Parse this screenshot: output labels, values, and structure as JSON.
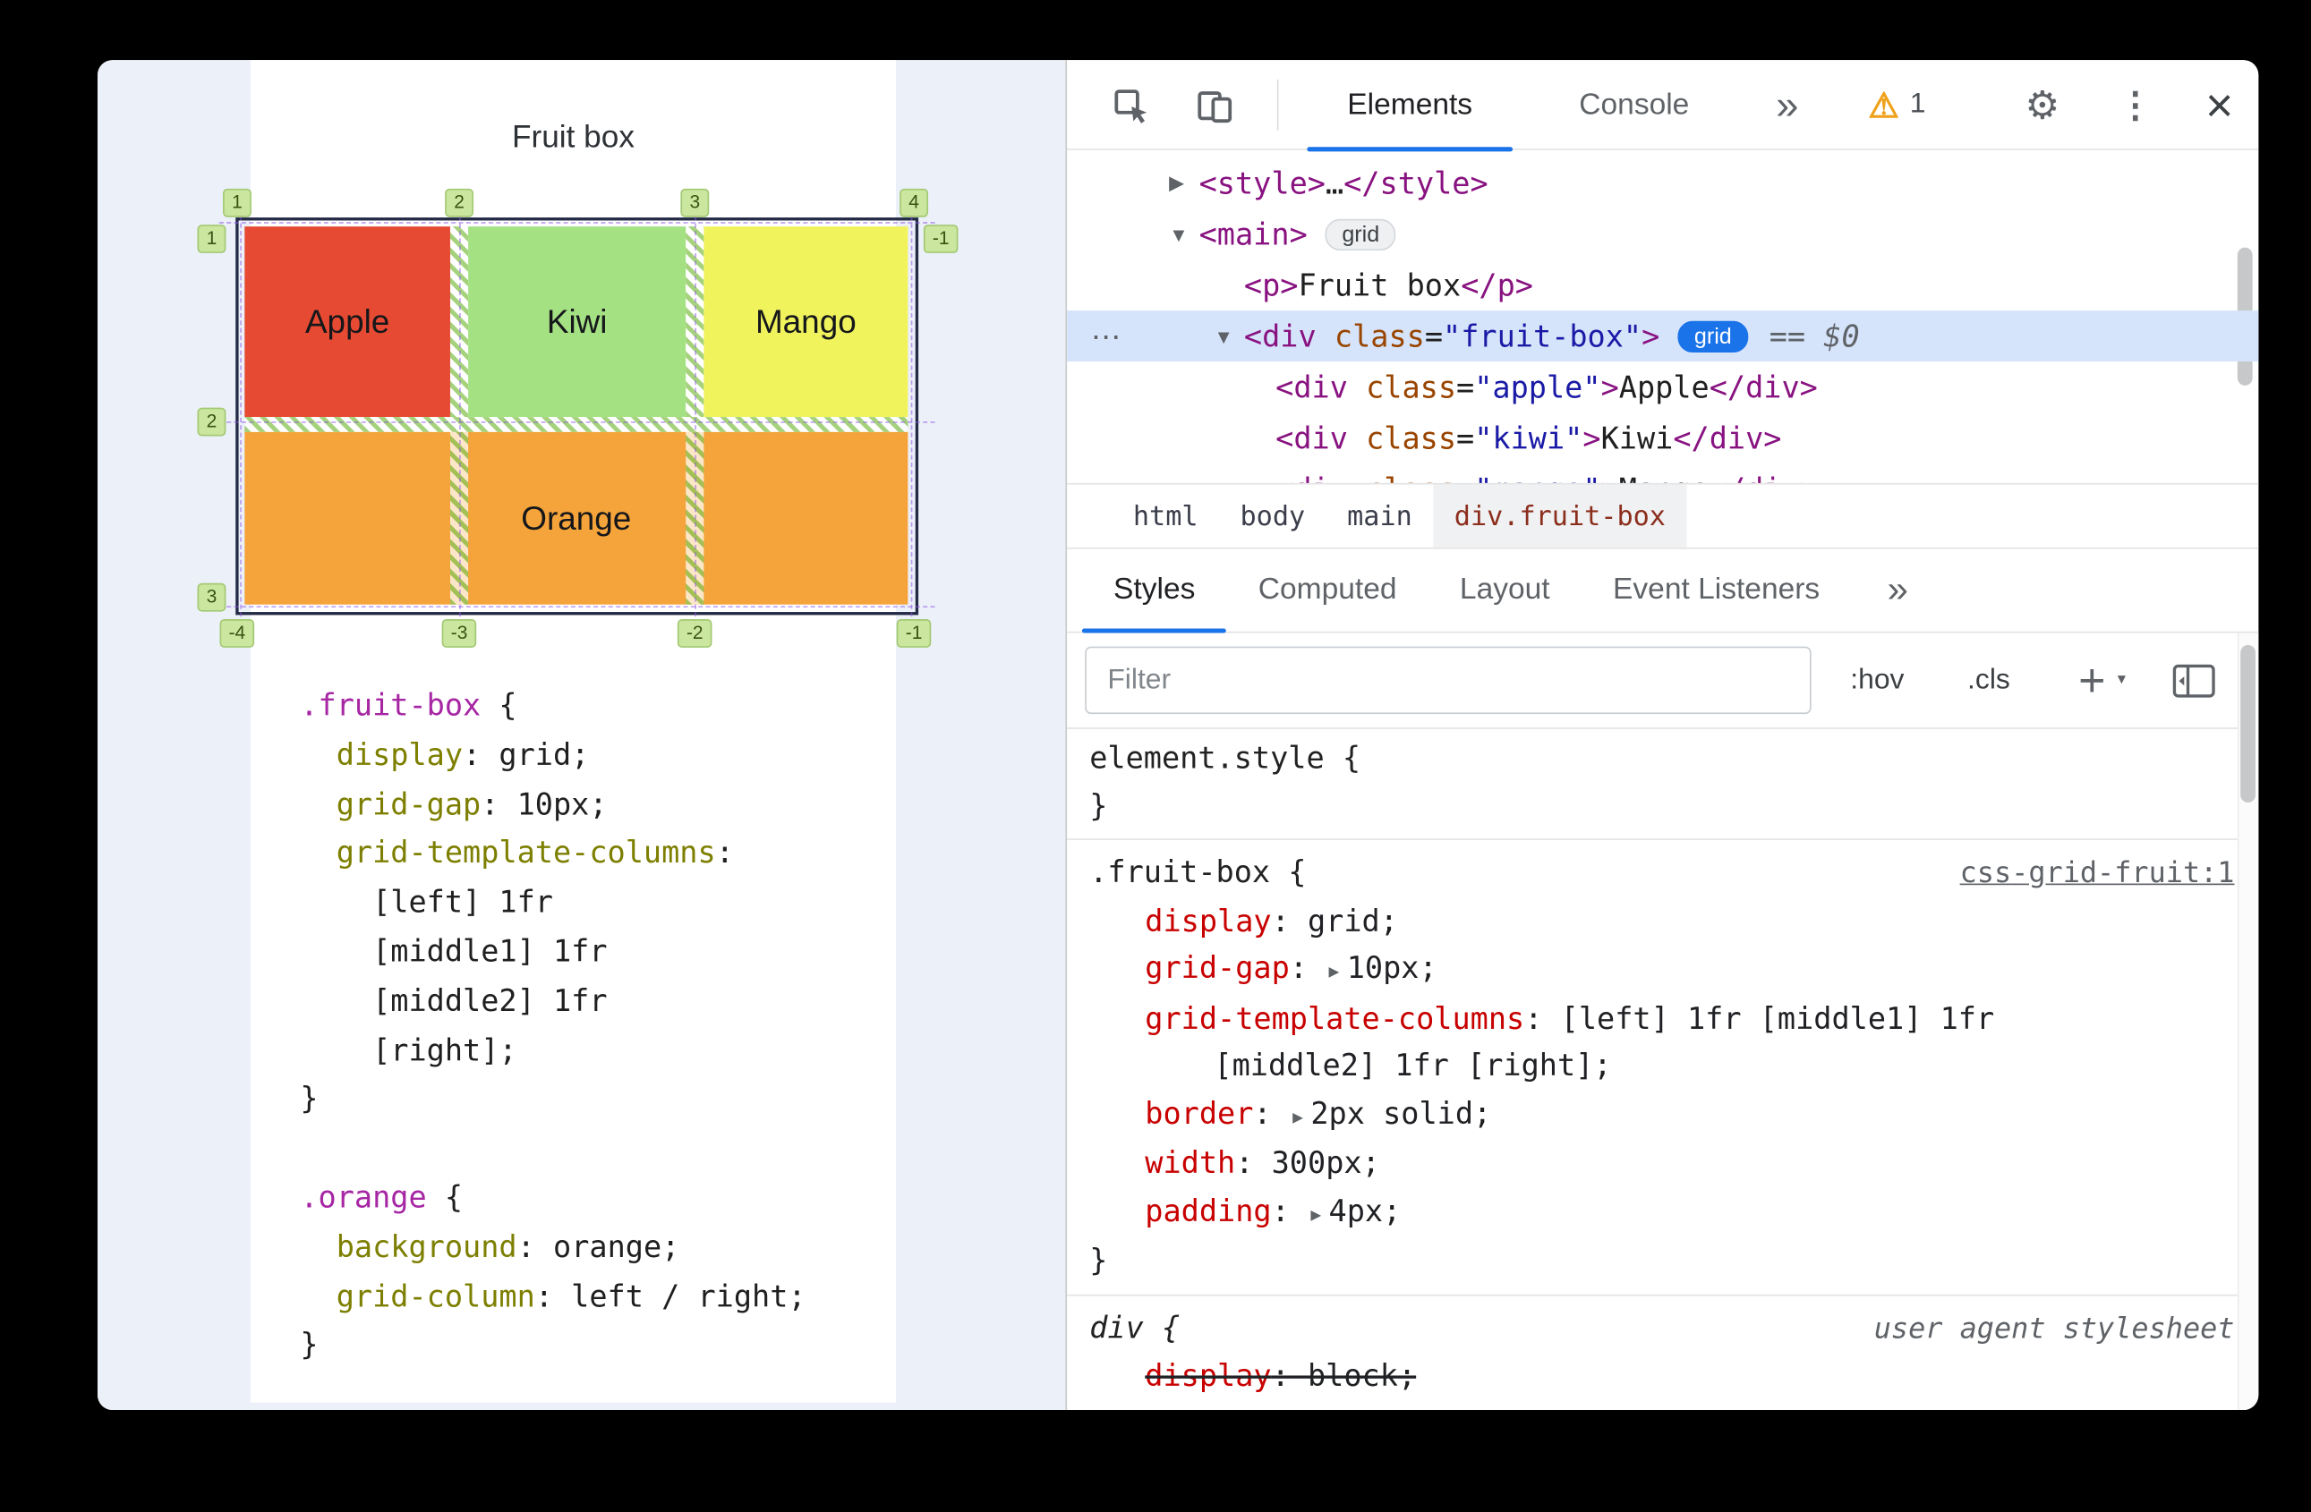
{
  "meta": {
    "accent_color": "#1a73e8",
    "selection_color": "#d6e4fb",
    "page_background": "#ecf0f8"
  },
  "page": {
    "title": "Fruit box",
    "grid_overlay": {
      "cells": {
        "apple": "Apple",
        "kiwi": "Kiwi",
        "mango": "Mango",
        "orange": "Orange"
      },
      "colors": {
        "apple": "#e64a33",
        "kiwi": "#a4e183",
        "mango": "#f0f35c",
        "orange": "#f5a43b"
      },
      "line_numbers": {
        "top": [
          "1",
          "2",
          "3",
          "4"
        ],
        "bottom": [
          "-4",
          "-3",
          "-2",
          "-1"
        ],
        "left": [
          "1",
          "2",
          "3"
        ],
        "right": [
          "-1"
        ]
      }
    },
    "code": [
      [
        [
          "sel",
          ".fruit-box"
        ],
        [
          "pln",
          " {"
        ]
      ],
      [
        [
          "pln",
          "  "
        ],
        [
          "prop",
          "display"
        ],
        [
          "pln",
          ": grid;"
        ]
      ],
      [
        [
          "pln",
          "  "
        ],
        [
          "prop",
          "grid-gap"
        ],
        [
          "pln",
          ": 10px;"
        ]
      ],
      [
        [
          "pln",
          "  "
        ],
        [
          "prop",
          "grid-template-columns"
        ],
        [
          "pln",
          ":"
        ]
      ],
      [
        [
          "pln",
          "    [left] 1fr"
        ]
      ],
      [
        [
          "pln",
          "    [middle1] 1fr"
        ]
      ],
      [
        [
          "pln",
          "    [middle2] 1fr"
        ]
      ],
      [
        [
          "pln",
          "    [right];"
        ]
      ],
      [
        [
          "pln",
          "}"
        ]
      ],
      [
        [
          "pln",
          ""
        ]
      ],
      [
        [
          "sel",
          ".orange"
        ],
        [
          "pln",
          " {"
        ]
      ],
      [
        [
          "pln",
          "  "
        ],
        [
          "prop",
          "background"
        ],
        [
          "pln",
          ": orange;"
        ]
      ],
      [
        [
          "pln",
          "  "
        ],
        [
          "prop",
          "grid-column"
        ],
        [
          "pln",
          ": left / right;"
        ]
      ],
      [
        [
          "pln",
          "}"
        ]
      ]
    ]
  },
  "devtools": {
    "toolbar": {
      "tabs": [
        "Elements",
        "Console"
      ],
      "active_tab": "Elements",
      "more_tabs_icon": "»",
      "warning_count": "1"
    },
    "dom_tree": [
      {
        "level": 1,
        "arrow": "▶",
        "tokens": [
          [
            "tag",
            "<style>"
          ],
          [
            "pln",
            "…"
          ],
          [
            "tag",
            "</style>"
          ]
        ]
      },
      {
        "level": 1,
        "arrow": "▼",
        "tokens": [
          [
            "tag",
            "<main>"
          ],
          [
            "badge",
            "grid"
          ]
        ]
      },
      {
        "level": 2,
        "arrow": "",
        "tokens": [
          [
            "tag",
            "<p>"
          ],
          [
            "pln",
            "Fruit box"
          ],
          [
            "tag",
            "</p>"
          ]
        ]
      },
      {
        "level": 2,
        "arrow": "▼",
        "selected": true,
        "tokens": [
          [
            "tag",
            "<div"
          ],
          [
            "attr",
            " class"
          ],
          [
            "pln",
            "="
          ],
          [
            "str",
            "\"fruit-box\""
          ],
          [
            "tag",
            ">"
          ],
          [
            "badge-on",
            "grid"
          ],
          [
            "eq",
            "== $0"
          ]
        ]
      },
      {
        "level": 3,
        "arrow": "",
        "tokens": [
          [
            "tag",
            "<div"
          ],
          [
            "attr",
            " class"
          ],
          [
            "pln",
            "="
          ],
          [
            "str",
            "\"apple\""
          ],
          [
            "tag",
            ">"
          ],
          [
            "pln",
            "Apple"
          ],
          [
            "tag",
            "</div>"
          ]
        ]
      },
      {
        "level": 3,
        "arrow": "",
        "tokens": [
          [
            "tag",
            "<div"
          ],
          [
            "attr",
            " class"
          ],
          [
            "pln",
            "="
          ],
          [
            "str",
            "\"kiwi\""
          ],
          [
            "tag",
            ">"
          ],
          [
            "pln",
            "Kiwi"
          ],
          [
            "tag",
            "</div>"
          ]
        ]
      },
      {
        "level": 3,
        "arrow": "",
        "clipped": true,
        "tokens": [
          [
            "tag",
            "<div"
          ],
          [
            "attr",
            " class"
          ],
          [
            "pln",
            "="
          ],
          [
            "str",
            "\"mango\""
          ],
          [
            "tag",
            ">"
          ],
          [
            "pln",
            "Mango"
          ],
          [
            "tag",
            "</div>"
          ]
        ]
      }
    ],
    "breadcrumbs": [
      {
        "label": "html"
      },
      {
        "label": "body"
      },
      {
        "label": "main"
      },
      {
        "label": "div.fruit-box",
        "selected": true
      }
    ],
    "styles_tabs": {
      "items": [
        "Styles",
        "Computed",
        "Layout",
        "Event Listeners"
      ],
      "active": "Styles",
      "more_tabs_icon": "»"
    },
    "filter": {
      "placeholder": "Filter",
      "pseudo_toggle": ":hov",
      "class_toggle": ".cls",
      "new_rule": "+"
    },
    "style_rules": [
      {
        "selector": "element.style",
        "link": "",
        "decls": []
      },
      {
        "selector": ".fruit-box",
        "link": "css-grid-fruit:1",
        "decls": [
          {
            "name": "display",
            "value": "grid"
          },
          {
            "name": "grid-gap",
            "value": "10px",
            "arrow": true
          },
          {
            "name": "grid-template-columns",
            "value": "[left] 1fr [middle1] 1fr [middle2] 1fr [right]"
          },
          {
            "name": "border",
            "value": "2px solid",
            "arrow": true
          },
          {
            "name": "width",
            "value": "300px"
          },
          {
            "name": "padding",
            "value": "4px",
            "arrow": true
          }
        ]
      },
      {
        "selector": "div",
        "link": "user agent stylesheet",
        "ua": true,
        "decls": [
          {
            "name": "display",
            "value": "block",
            "struck": true
          }
        ]
      }
    ]
  }
}
